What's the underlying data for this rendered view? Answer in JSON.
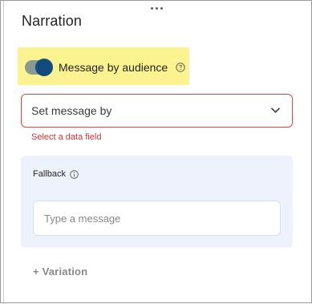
{
  "panel": {
    "title": "Narration"
  },
  "toggle": {
    "label": "Message by audience",
    "checked": true,
    "track_color": "#8a9a94",
    "knob_color": "#104c7d",
    "highlight_color": "#fbf38f"
  },
  "select": {
    "value": "Set message by",
    "error_text": "Select a data field",
    "error_color": "#d13438"
  },
  "fallback": {
    "label": "Fallback",
    "input_placeholder": "Type a message",
    "input_value": "",
    "card_color": "#eef2fc"
  },
  "variation": {
    "label": "+ Variation"
  },
  "icons": {
    "drag": "drag-handle-icon",
    "help": "help-circle-icon",
    "chevron": "chevron-down-icon",
    "info": "info-circle-icon"
  }
}
